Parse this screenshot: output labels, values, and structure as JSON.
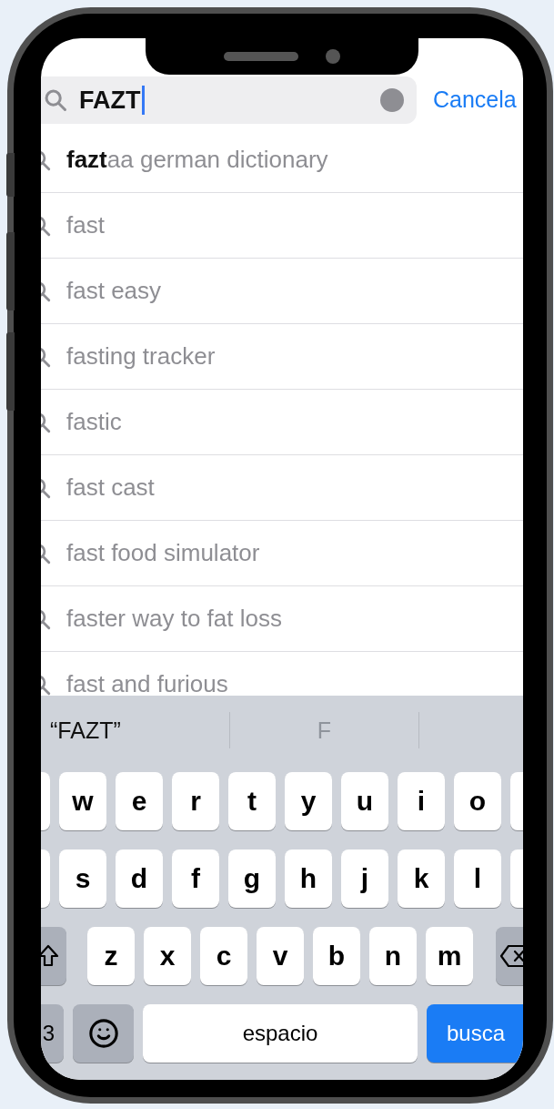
{
  "search": {
    "value": "FAZT",
    "cancel": "Cancela"
  },
  "suggestions": [
    {
      "text": "**fazt**aa german dictionary"
    },
    {
      "text": "fast"
    },
    {
      "text": "fast easy"
    },
    {
      "text": "fasting tracker"
    },
    {
      "text": "fastic"
    },
    {
      "text": "fast cast"
    },
    {
      "text": "fast food simulator"
    },
    {
      "text": "faster way to fat loss"
    },
    {
      "text": "fast and furious"
    }
  ],
  "keyboard": {
    "predictions": [
      {
        "text": "“FAZT”",
        "disabled": false
      },
      {
        "text": "F",
        "disabled": true
      }
    ],
    "rows": [
      {
        "keys": [
          {
            "kind": "blank"
          },
          {
            "kind": "letter",
            "label": "w"
          },
          {
            "kind": "letter",
            "label": "e"
          },
          {
            "kind": "letter",
            "label": "r"
          },
          {
            "kind": "letter",
            "label": "t"
          },
          {
            "kind": "letter",
            "label": "y"
          },
          {
            "kind": "letter",
            "label": "u"
          },
          {
            "kind": "letter",
            "label": "i"
          },
          {
            "kind": "letter",
            "label": "o"
          },
          {
            "kind": "blank"
          }
        ]
      },
      {
        "keys": [
          {
            "kind": "blank"
          },
          {
            "kind": "letter",
            "label": "s"
          },
          {
            "kind": "letter",
            "label": "d"
          },
          {
            "kind": "letter",
            "label": "f"
          },
          {
            "kind": "letter",
            "label": "g"
          },
          {
            "kind": "letter",
            "label": "h"
          },
          {
            "kind": "letter",
            "label": "j"
          },
          {
            "kind": "letter",
            "label": "k"
          },
          {
            "kind": "letter",
            "label": "l"
          },
          {
            "kind": "blank"
          }
        ]
      },
      {
        "keys": [
          {
            "kind": "shift"
          },
          {
            "kind": "letter",
            "label": "z"
          },
          {
            "kind": "letter",
            "label": "x"
          },
          {
            "kind": "letter",
            "label": "c"
          },
          {
            "kind": "letter",
            "label": "v"
          },
          {
            "kind": "letter",
            "label": "b"
          },
          {
            "kind": "letter",
            "label": "n"
          },
          {
            "kind": "letter",
            "label": "m"
          },
          {
            "kind": "delete"
          }
        ]
      },
      {
        "keys": [
          {
            "kind": "mode",
            "label": "3"
          },
          {
            "kind": "emoji"
          },
          {
            "kind": "space",
            "label": "espacio"
          },
          {
            "kind": "action",
            "label": "busca"
          }
        ]
      }
    ]
  }
}
